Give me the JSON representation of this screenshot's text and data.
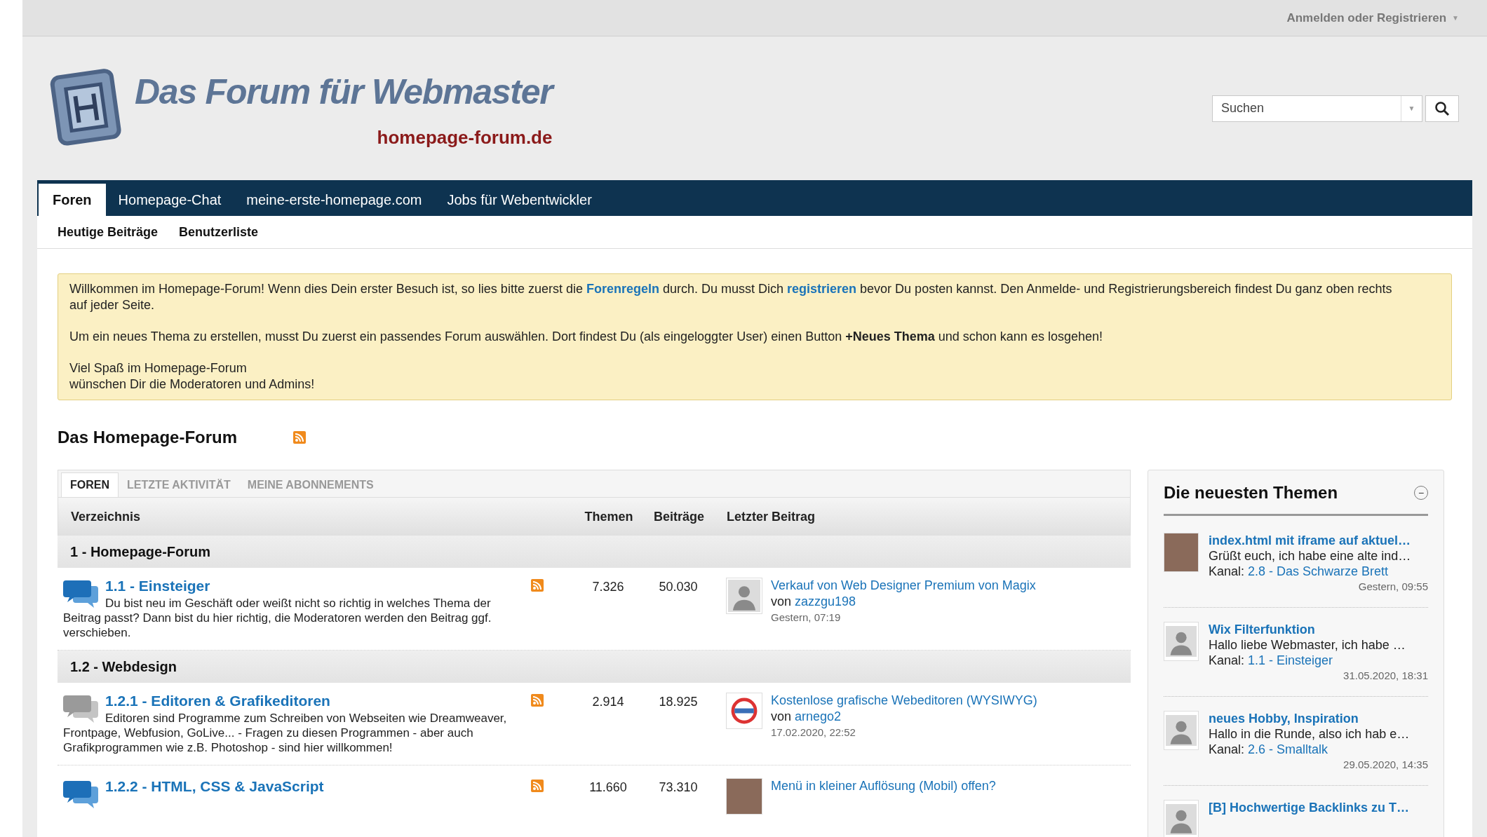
{
  "top_bar": {
    "login_link": "Anmelden oder Registrieren",
    "caret": "▼"
  },
  "header": {
    "logo_title": "Das Forum für Webmaster",
    "logo_domain": "homepage-forum.de",
    "search": {
      "placeholder": "Suchen",
      "caret": "▼"
    }
  },
  "nav": {
    "tabs": [
      {
        "label": "Foren",
        "selected": true
      },
      {
        "label": "Homepage-Chat",
        "selected": false
      },
      {
        "label": "meine-erste-homepage.com",
        "selected": false
      },
      {
        "label": "Jobs für Webentwickler",
        "selected": false
      }
    ],
    "sub_links": [
      "Heutige Beiträge",
      "Benutzerliste"
    ]
  },
  "notice": {
    "paragraphs": [
      [
        {
          "kind": "text",
          "text": "Willkommen im Homepage-Forum! Wenn dies Dein erster Besuch ist, so lies bitte zuerst die "
        },
        {
          "kind": "link",
          "text": "Forenregeln"
        },
        {
          "kind": "text",
          "text": " durch. Du musst Dich "
        },
        {
          "kind": "link",
          "text": "registrieren"
        },
        {
          "kind": "text",
          "text": " bevor Du posten kannst. Den Anmelde- und Registrierungsbereich findest Du ganz oben rechts auf jeder Seite."
        }
      ],
      "Um ein neues Thema zu erstellen, musst Du zuerst ein passendes Forum auswählen. Dort findest Du (als eingeloggter User) einen Button **+Neues Thema** und schon kann es losgehen!",
      "Viel Spaß im Homepage-Forum\nwünschen Dir die Moderatoren und Admins!"
    ]
  },
  "forum": {
    "title": "Das Homepage-Forum",
    "tabs": [
      {
        "label": "FOREN",
        "selected": true
      },
      {
        "label": "LETZTE AKTIVITÄT",
        "selected": false
      },
      {
        "label": "MEINE ABONNEMENTS",
        "selected": false
      }
    ],
    "columns": [
      "Verzeichnis",
      "Themen",
      "Beiträge",
      "Letzter Beitrag"
    ],
    "sections": [
      {
        "title": "1 - Homepage-Forum",
        "forums": [
          {
            "name": "1.1 - Einsteiger",
            "unread": true,
            "description": "Du bist neu im Geschäft oder weißt nicht so richtig in welches Thema der Beitrag passt? Dann bist du hier richtig, die Moderatoren werden den Beitrag ggf. verschieben.",
            "topics": "7.326",
            "posts": "50.030",
            "last_post": {
              "avatar": {
                "kind": "silhouette"
              },
              "title": "Verkauf von Web Designer Premium von Magix",
              "by": "von",
              "user": "zazzgu198",
              "time": "Gestern, 07:19"
            }
          }
        ]
      },
      {
        "title": "1.2 - Webdesign",
        "forums": [
          {
            "name": "1.2.1 - Editoren & Grafikeditoren",
            "unread": false,
            "description": "Editoren sind Programme zum Schreiben von Webseiten wie Dreamweaver, Frontpage, Webfusion, GoLive... - Fragen zu diesen Programmen - aber auch Grafikprogrammen wie z.B. Photoshop - sind hier willkommen!",
            "topics": "2.914",
            "posts": "18.925",
            "last_post": {
              "avatar": {
                "kind": "logo"
              },
              "title": "Kostenlose grafische Webeditoren (WYSIWYG)",
              "by": "von",
              "user": "arnego2",
              "time": "17.02.2020, 22:52"
            }
          },
          {
            "name": "1.2.2 - HTML, CSS & JavaScript",
            "unread": true,
            "topics": "11.660",
            "posts": "73.310",
            "last_post": {
              "avatar": {
                "kind": "photo"
              },
              "title": "Menü in kleiner Auflösung (Mobil) offen?"
            }
          }
        ]
      }
    ]
  },
  "sidebar": {
    "title": "Die neuesten Themen",
    "collapse": "−",
    "items": [
      {
        "avatar": {
          "kind": "photo"
        },
        "title": "index.html mit iframe auf aktuel…",
        "excerpt": "Grüßt euch, ich habe eine alte ind…",
        "channel_label": "Kanal:",
        "channel": "2.8 - Das Schwarze Brett",
        "time": "Gestern, 09:55"
      },
      {
        "avatar": {
          "kind": "silhouette"
        },
        "title": "Wix Filterfunktion",
        "excerpt": "Hallo liebe Webmaster, ich habe …",
        "channel_label": "Kanal:",
        "channel": "1.1 - Einsteiger",
        "time": "31.05.2020, 18:31"
      },
      {
        "avatar": {
          "kind": "silhouette"
        },
        "title": "neues Hobby, Inspiration",
        "excerpt": "Hallo in die Runde, also ich hab e…",
        "channel_label": "Kanal:",
        "channel": "2.6 - Smalltalk",
        "time": "29.05.2020, 14:35"
      },
      {
        "avatar": {
          "kind": "silhouette"
        },
        "title": "[B] Hochwertige Backlinks zu T…"
      }
    ]
  }
}
